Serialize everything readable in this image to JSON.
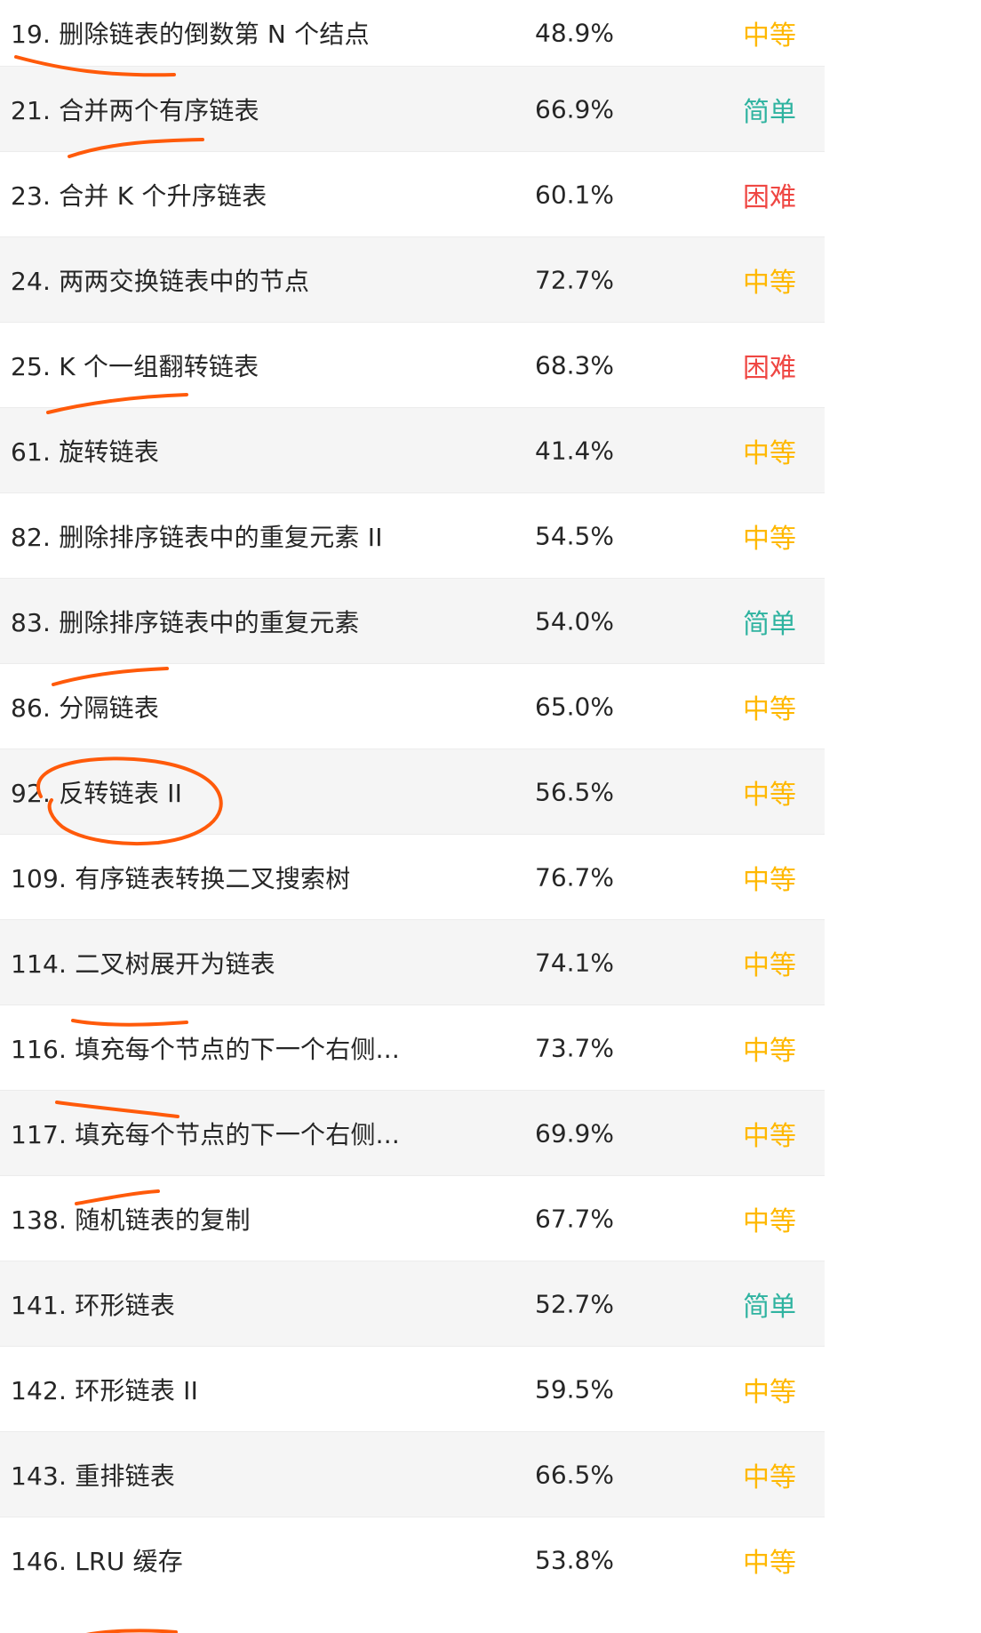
{
  "problems": [
    {
      "title": "19. 删除链表的倒数第 N 个结点",
      "rate": "48.9%",
      "difficulty": "中等",
      "level": "medium"
    },
    {
      "title": "21. 合并两个有序链表",
      "rate": "66.9%",
      "difficulty": "简单",
      "level": "easy"
    },
    {
      "title": "23. 合并 K 个升序链表",
      "rate": "60.1%",
      "difficulty": "困难",
      "level": "hard"
    },
    {
      "title": "24. 两两交换链表中的节点",
      "rate": "72.7%",
      "difficulty": "中等",
      "level": "medium"
    },
    {
      "title": "25. K 个一组翻转链表",
      "rate": "68.3%",
      "difficulty": "困难",
      "level": "hard"
    },
    {
      "title": "61. 旋转链表",
      "rate": "41.4%",
      "difficulty": "中等",
      "level": "medium"
    },
    {
      "title": "82. 删除排序链表中的重复元素 II",
      "rate": "54.5%",
      "difficulty": "中等",
      "level": "medium"
    },
    {
      "title": "83. 删除排序链表中的重复元素",
      "rate": "54.0%",
      "difficulty": "简单",
      "level": "easy"
    },
    {
      "title": "86. 分隔链表",
      "rate": "65.0%",
      "difficulty": "中等",
      "level": "medium"
    },
    {
      "title": "92. 反转链表 II",
      "rate": "56.5%",
      "difficulty": "中等",
      "level": "medium"
    },
    {
      "title": "109. 有序链表转换二叉搜索树",
      "rate": "76.7%",
      "difficulty": "中等",
      "level": "medium"
    },
    {
      "title": "114. 二叉树展开为链表",
      "rate": "74.1%",
      "difficulty": "中等",
      "level": "medium"
    },
    {
      "title": "116. 填充每个节点的下一个右侧...",
      "rate": "73.7%",
      "difficulty": "中等",
      "level": "medium"
    },
    {
      "title": "117. 填充每个节点的下一个右侧...",
      "rate": "69.9%",
      "difficulty": "中等",
      "level": "medium"
    },
    {
      "title": "138. 随机链表的复制",
      "rate": "67.7%",
      "difficulty": "中等",
      "level": "medium"
    },
    {
      "title": "141. 环形链表",
      "rate": "52.7%",
      "difficulty": "简单",
      "level": "easy"
    },
    {
      "title": "142. 环形链表 II",
      "rate": "59.5%",
      "difficulty": "中等",
      "level": "medium"
    },
    {
      "title": "143. 重排链表",
      "rate": "66.5%",
      "difficulty": "中等",
      "level": "medium"
    },
    {
      "title": "146. LRU 缓存",
      "rate": "53.8%",
      "difficulty": "中等",
      "level": "medium"
    }
  ],
  "colors": {
    "easy": "#2fb3a0",
    "medium": "#ffb800",
    "hard": "#ef4743",
    "annotation": "#ff5a0a"
  }
}
